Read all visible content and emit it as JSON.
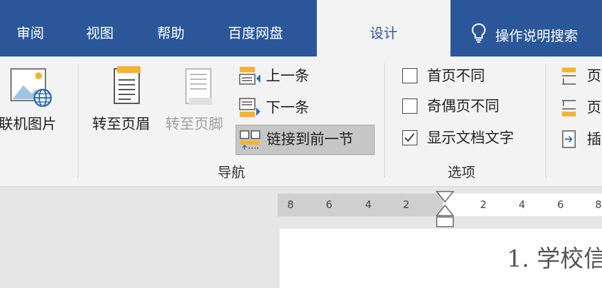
{
  "tabs": {
    "review": "审阅",
    "view": "视图",
    "help": "帮助",
    "baidu": "百度网盘",
    "design": "设计",
    "tell_me": "操作说明搜索"
  },
  "ribbon": {
    "online_pictures": "联机图片",
    "goto_header": "转至页眉",
    "goto_footer": "转至页脚",
    "previous": "上一条",
    "next": "下一条",
    "link_to_previous": "链接到前一节",
    "nav_group": "导航",
    "diff_first_page": "首页不同",
    "diff_odd_even": "奇偶页不同",
    "show_doc_text": "显示文档文字",
    "options_group": "选项",
    "pos_1": "页",
    "pos_2": "页",
    "pos_3": "插"
  },
  "ruler": {
    "ticks_left": [
      "8",
      "6",
      "4",
      "2"
    ],
    "ticks_right": [
      "2",
      "4",
      "6",
      "8"
    ]
  },
  "document": {
    "text": "1. 学校信"
  },
  "colors": {
    "accent": "#2b579a",
    "ribbon_bg": "#f3f3f3",
    "icon_orange": "#f5b335",
    "icon_blue": "#2f6db5"
  }
}
